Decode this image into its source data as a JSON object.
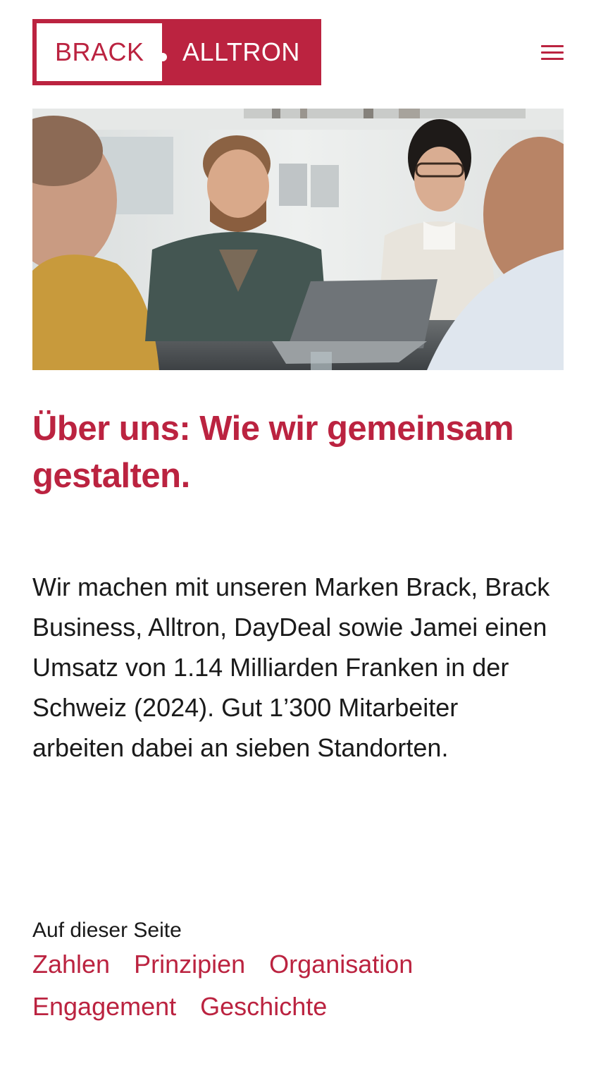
{
  "logo": {
    "left_text": "BRACK",
    "right_text": "ALLTRON"
  },
  "header": {
    "menu_icon": "hamburger-menu-icon"
  },
  "hero": {
    "image": "office-team-meeting-photo"
  },
  "page": {
    "title": "Über uns: Wie wir gemeinsam gestalten.",
    "intro": "Wir machen mit unseren Marken Brack, Brack Business, Alltron, DayDeal sowie Jamei einen Umsatz von 1.14 Milliarden Franken in der Schweiz (2024). Gut 1’300 Mitarbeiter arbeiten dabei an sieben Standorten."
  },
  "toc": {
    "label": "Auf dieser Seite",
    "links": [
      "Zahlen",
      "Prinzipien",
      "Organisation",
      "Engagement",
      "Geschichte"
    ]
  },
  "colors": {
    "brand": "#bb2340",
    "text": "#1a1a1a",
    "background": "#ffffff"
  }
}
